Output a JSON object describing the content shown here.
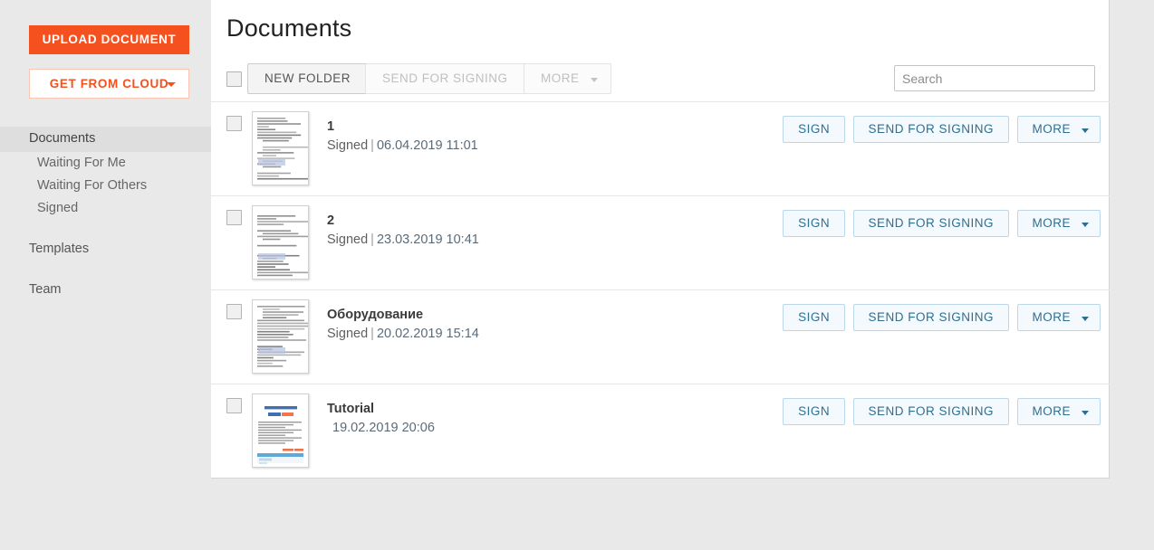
{
  "sidebar": {
    "upload_button": "UPLOAD DOCUMENT",
    "cloud_button": "GET FROM CLOUD",
    "items": [
      {
        "label": "Documents",
        "active": true,
        "sub": false
      },
      {
        "label": "Waiting For Me",
        "active": false,
        "sub": true
      },
      {
        "label": "Waiting For Others",
        "active": false,
        "sub": true
      },
      {
        "label": "Signed",
        "active": false,
        "sub": true
      },
      {
        "label": "Templates",
        "active": false,
        "sub": false
      },
      {
        "label": "Team",
        "active": false,
        "sub": false
      }
    ],
    "accent_color": "#f4511e"
  },
  "main": {
    "title": "Documents",
    "toolbar": {
      "new_folder_label": "NEW FOLDER",
      "send_for_signing_label": "SEND FOR SIGNING",
      "more_label": "MORE"
    },
    "search": {
      "placeholder": "Search",
      "value": ""
    },
    "row_actions": {
      "sign_label": "SIGN",
      "send_label": "SEND FOR SIGNING",
      "more_label": "MORE"
    },
    "documents": [
      {
        "name": "1",
        "status": "Signed",
        "separator": "|",
        "date": "06.04.2019 11:01",
        "thumbnail": "text-document"
      },
      {
        "name": "2",
        "status": "Signed",
        "separator": "|",
        "date": "23.03.2019 10:41",
        "thumbnail": "text-document"
      },
      {
        "name": "Оборудование",
        "status": "Signed",
        "separator": "|",
        "date": "20.02.2019 15:14",
        "thumbnail": "text-document"
      },
      {
        "name": "Tutorial",
        "status": "",
        "separator": "",
        "date": "19.02.2019 20:06",
        "thumbnail": "tutorial-document"
      }
    ]
  }
}
